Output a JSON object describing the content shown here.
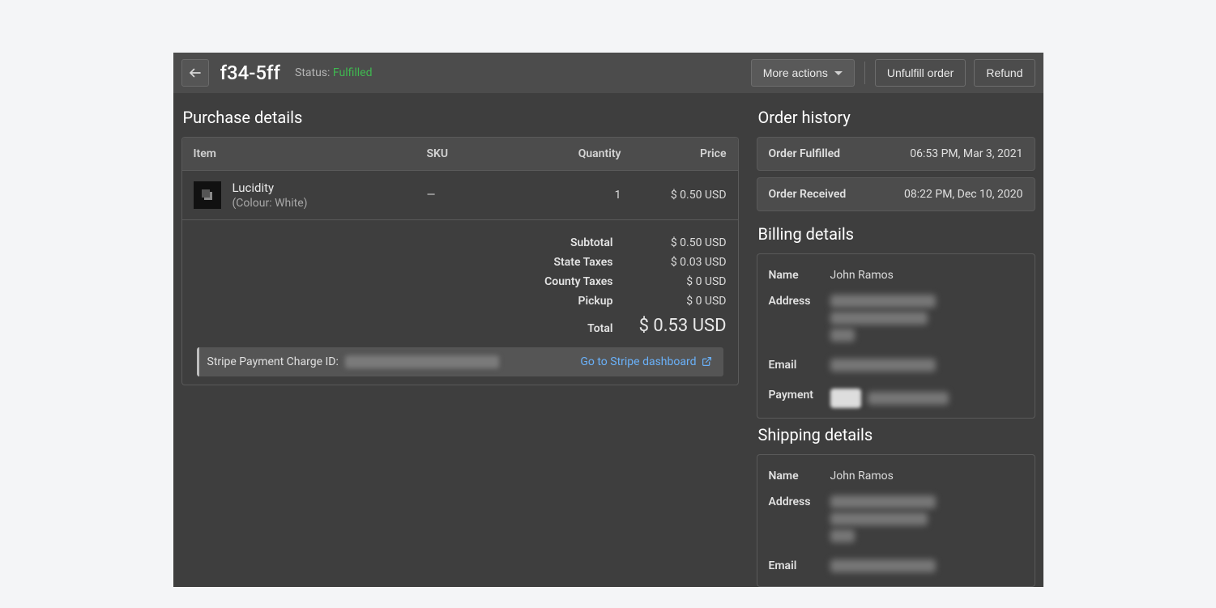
{
  "header": {
    "order_id": "f34-5ff",
    "status_label": "Status:",
    "status_value": "Fulfilled",
    "more_actions": "More actions",
    "unfulfill": "Unfulfill order",
    "refund": "Refund"
  },
  "purchase": {
    "title": "Purchase details",
    "columns": {
      "item": "Item",
      "sku": "SKU",
      "qty": "Quantity",
      "price": "Price"
    },
    "items": [
      {
        "name": "Lucidity",
        "variant": "(Colour: White)",
        "sku": "—",
        "qty": "1",
        "price": "$ 0.50 USD"
      }
    ],
    "totals": {
      "subtotal_label": "Subtotal",
      "subtotal": "$ 0.50 USD",
      "state_tax_label": "State Taxes",
      "state_tax": "$ 0.03 USD",
      "county_tax_label": "County Taxes",
      "county_tax": "$ 0 USD",
      "pickup_label": "Pickup",
      "pickup": "$ 0 USD",
      "total_label": "Total",
      "total": "$ 0.53 USD"
    },
    "stripe": {
      "label": "Stripe Payment Charge ID:",
      "link": "Go to Stripe dashboard"
    }
  },
  "history": {
    "title": "Order history",
    "items": [
      {
        "label": "Order Fulfilled",
        "time": "06:53 PM, Mar 3, 2021"
      },
      {
        "label": "Order Received",
        "time": "08:22 PM, Dec 10, 2020"
      }
    ]
  },
  "billing": {
    "title": "Billing details",
    "name_label": "Name",
    "name": "John Ramos",
    "address_label": "Address",
    "email_label": "Email",
    "payment_label": "Payment"
  },
  "shipping": {
    "title": "Shipping details",
    "name_label": "Name",
    "name": "John Ramos",
    "address_label": "Address",
    "email_label": "Email"
  }
}
